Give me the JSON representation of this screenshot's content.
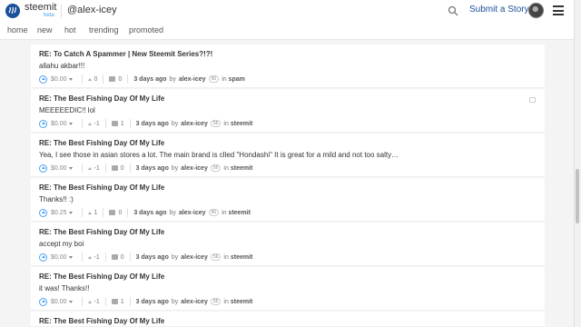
{
  "header": {
    "brand": "steemit",
    "beta": "beta",
    "username": "@alex-icey",
    "submit": "Submit a Story"
  },
  "nav": [
    "home",
    "new",
    "hot",
    "trending",
    "promoted"
  ],
  "items": [
    {
      "title": "RE: To Catch A Spammer | New Steemit Series?!?!",
      "body": "allahu akbar!!!",
      "payout": "$0.00",
      "votes": "0",
      "comments": "0",
      "time": "3 days ago",
      "by": "by",
      "author": "alex-icey",
      "rep": "56",
      "in": "in",
      "category": "spam"
    },
    {
      "title": "RE: The Best Fishing Day Of My Life",
      "body": "MEEEEEDIC!! lol",
      "payout": "$0.00",
      "votes": "-1",
      "comments": "1",
      "time": "3 days ago",
      "by": "by",
      "author": "alex-icey",
      "rep": "56",
      "in": "in",
      "category": "steemit"
    },
    {
      "title": "RE: The Best Fishing Day Of My Life",
      "body": "Yea, I see those in asian stores a lot. The main brand is clled \"Hondashi\" It is great for a mild and not too salty…",
      "payout": "$0.00",
      "votes": "-1",
      "comments": "0",
      "time": "3 days ago",
      "by": "by",
      "author": "alex-icey",
      "rep": "56",
      "in": "in",
      "category": "steemit"
    },
    {
      "title": "RE: The Best Fishing Day Of My Life",
      "body": "Thanks!! :)",
      "payout": "$0.25",
      "votes": "1",
      "comments": "0",
      "time": "3 days ago",
      "by": "by",
      "author": "alex-icey",
      "rep": "56",
      "in": "in",
      "category": "steemit"
    },
    {
      "title": "RE: The Best Fishing Day Of My Life",
      "body": "accept my boi",
      "payout": "$0.00",
      "votes": "-1",
      "comments": "0",
      "time": "3 days ago",
      "by": "by",
      "author": "alex-icey",
      "rep": "56",
      "in": "in",
      "category": "steemit"
    },
    {
      "title": "RE: The Best Fishing Day Of My Life",
      "body": "it was! Thanks!!",
      "payout": "$0.00",
      "votes": "-1",
      "comments": "1",
      "time": "3 days ago",
      "by": "by",
      "author": "alex-icey",
      "rep": "56",
      "in": "in",
      "category": "steemit"
    },
    {
      "title": "RE: The Best Fishing Day Of My Life",
      "body": "",
      "payout": "",
      "votes": "",
      "comments": "",
      "time": "",
      "by": "",
      "author": "",
      "rep": "",
      "in": "",
      "category": ""
    }
  ]
}
